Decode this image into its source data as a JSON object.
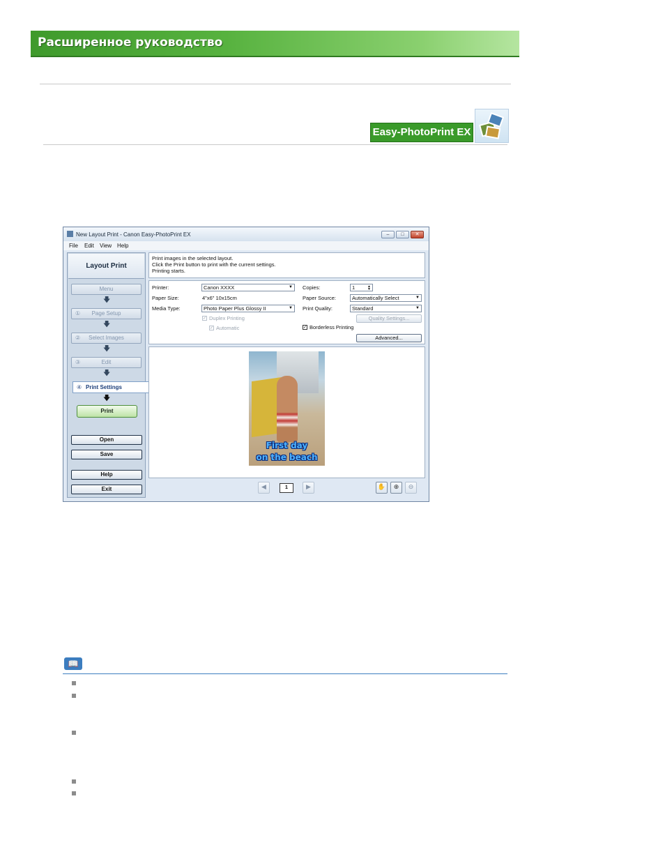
{
  "banner": {
    "title": "Расширенное руководство"
  },
  "brand": {
    "label": "Easy-PhotoPrint EX"
  },
  "window": {
    "title": "New Layout Print - Canon Easy-PhotoPrint EX",
    "controls": {
      "minimize": "–",
      "maximize": "□",
      "close": "✕"
    },
    "menu": [
      "File",
      "Edit",
      "View",
      "Help"
    ],
    "sidebar": {
      "title": "Layout Print",
      "menu_label": "Menu",
      "steps": [
        {
          "num": "①",
          "label": "Page Setup"
        },
        {
          "num": "②",
          "label": "Select Images"
        },
        {
          "num": "③",
          "label": "Edit"
        },
        {
          "num": "④",
          "label": "Print Settings"
        }
      ],
      "arrow": "🡇",
      "print": "Print",
      "open": "Open",
      "save": "Save",
      "help": "Help",
      "exit": "Exit"
    },
    "description": [
      "Print images in the selected layout.",
      "Click the Print button to print with the current settings.",
      "Printing starts."
    ],
    "settings": {
      "printer_label": "Printer:",
      "printer_value": "Canon XXXX",
      "paper_size_label": "Paper Size:",
      "paper_size_value": "4\"x6\" 10x15cm",
      "media_type_label": "Media Type:",
      "media_type_value": "Photo Paper Plus Glossy II",
      "duplex_label": "Duplex Printing",
      "automatic_label": "Automatic",
      "copies_label": "Copies:",
      "copies_value": "1",
      "paper_source_label": "Paper Source:",
      "paper_source_value": "Automatically Select",
      "print_quality_label": "Print Quality:",
      "print_quality_value": "Standard",
      "quality_settings_button": "Quality Settings...",
      "borderless_label": "Borderless Printing",
      "advanced_button": "Advanced..."
    },
    "preview": {
      "caption_line1": "First day",
      "caption_line2": "on the beach"
    },
    "pager": {
      "current_page": "1",
      "prev": "◀",
      "next": "▶"
    },
    "tools": {
      "hand": "✋",
      "zoom_in": "⊕",
      "zoom_out": "⊖"
    }
  },
  "note": {
    "icon": "📖"
  }
}
